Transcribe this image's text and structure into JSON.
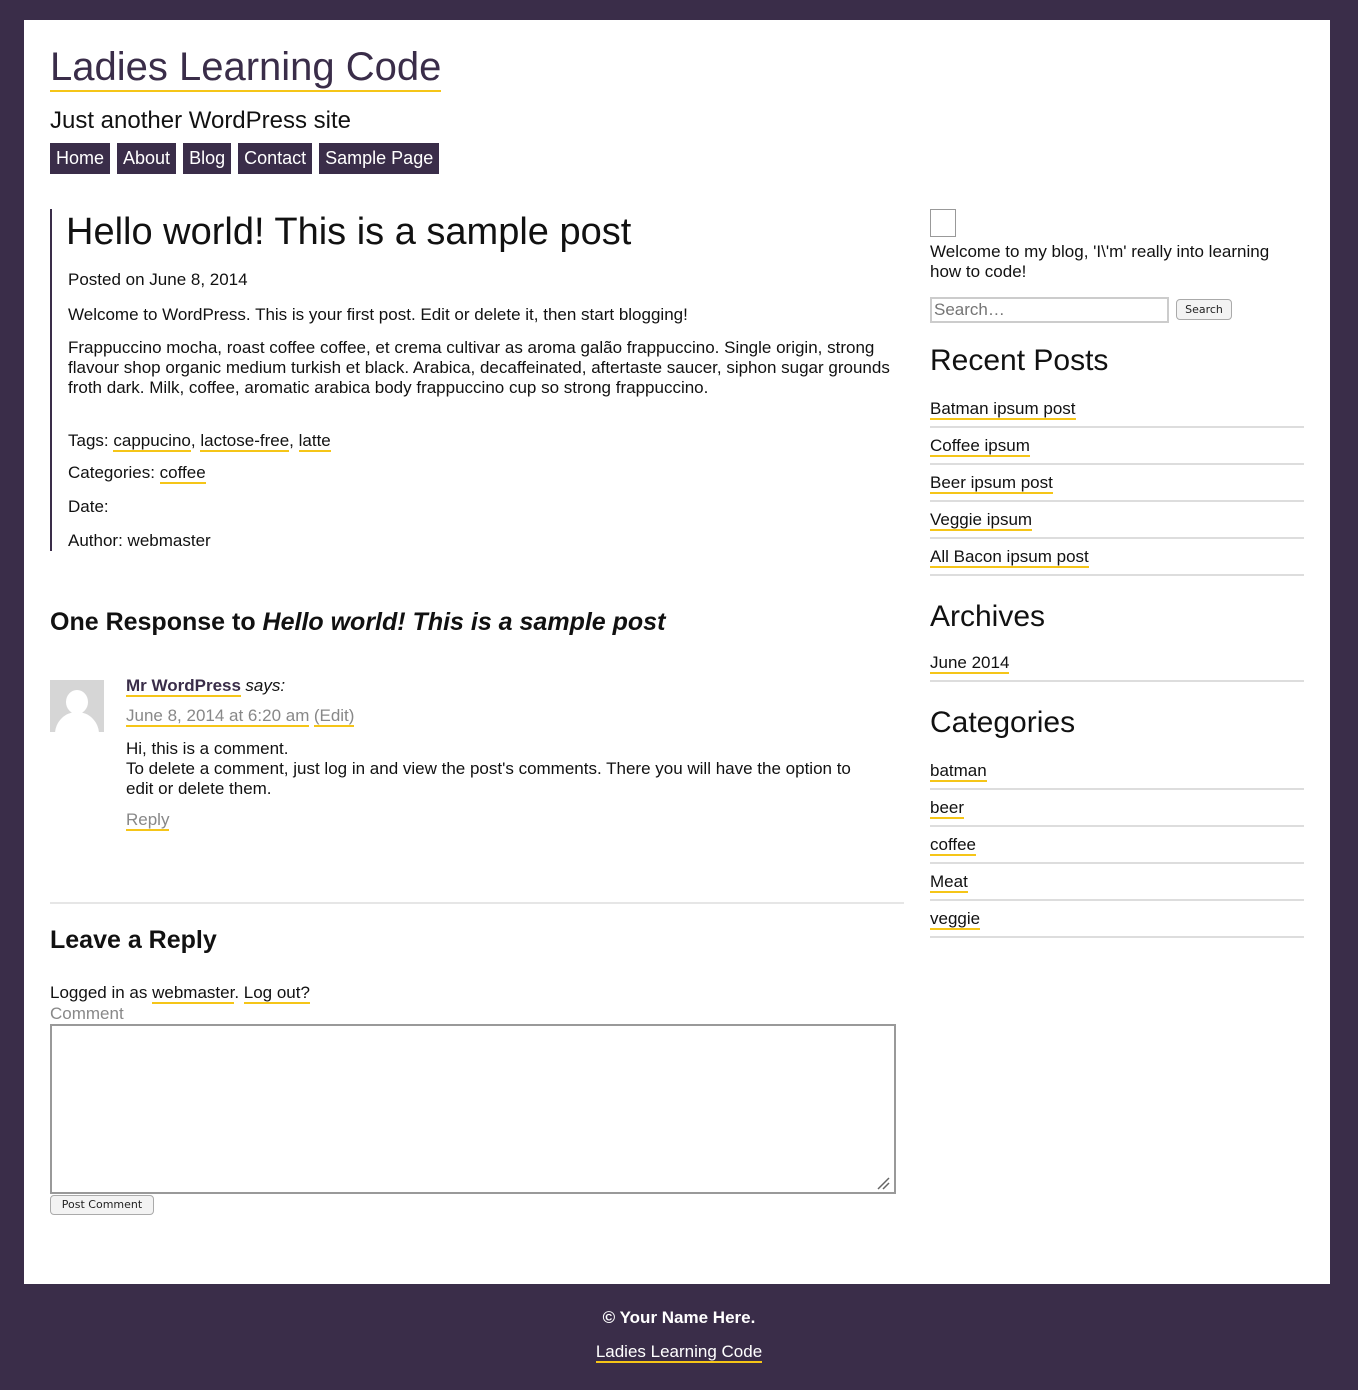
{
  "site": {
    "title": "Ladies Learning Code",
    "tagline": "Just another WordPress site"
  },
  "nav": [
    "Home",
    "About",
    "Blog",
    "Contact",
    "Sample Page"
  ],
  "post": {
    "title": "Hello world! This is a sample post",
    "posted_on": "Posted on June 8, 2014",
    "intro": "Welcome to WordPress. This is your first post. Edit or delete it, then start blogging!",
    "body": "Frappuccino mocha, roast coffee coffee, et crema cultivar as aroma galão frappuccino. Single origin, strong flavour shop organic medium turkish et black. Arabica, decaffeinated, aftertaste saucer, siphon sugar grounds froth dark. Milk, coffee, aromatic arabica body frappuccino cup so strong frappuccino.",
    "tags_label": "Tags:",
    "tags": [
      "cappucino",
      "lactose-free",
      "latte"
    ],
    "categories_label": "Categories:",
    "category": "coffee",
    "date_label": "Date:",
    "author_label": "Author:",
    "author": "webmaster"
  },
  "comments": {
    "title_prefix": "One Response to",
    "title_post": "Hello world! This is a sample post",
    "items": [
      {
        "author": "Mr WordPress",
        "says": "says:",
        "date": "June 8, 2014 at 6:20 am",
        "edit": "(Edit)",
        "line1": "Hi, this is a comment.",
        "line2": "To delete a comment, just log in and view the post's comments. There you will have the option to edit or delete them.",
        "reply": "Reply"
      }
    ]
  },
  "reply_form": {
    "title": "Leave a Reply",
    "logged_in_prefix": "Logged in as",
    "user": "webmaster",
    "logout": "Log out?",
    "comment_label": "Comment",
    "submit": "Post Comment"
  },
  "sidebar": {
    "welcome": "Welcome to my blog, 'I\\'m' really into learning how to code!",
    "search_placeholder": "Search…",
    "search_button": "Search",
    "recent_posts_title": "Recent Posts",
    "recent_posts": [
      "Batman ipsum post",
      "Coffee ipsum",
      "Beer ipsum post",
      "Veggie ipsum",
      "All Bacon ipsum post"
    ],
    "archives_title": "Archives",
    "archives": [
      "June 2014"
    ],
    "categories_title": "Categories",
    "categories": [
      "batman",
      "beer",
      "coffee",
      "Meat",
      "veggie"
    ]
  },
  "footer": {
    "copyright": "© Your Name Here.",
    "credit": "Ladies Learning Code"
  },
  "colors": {
    "brand": "#3a2d49",
    "accent_underline": "#f5c518"
  }
}
